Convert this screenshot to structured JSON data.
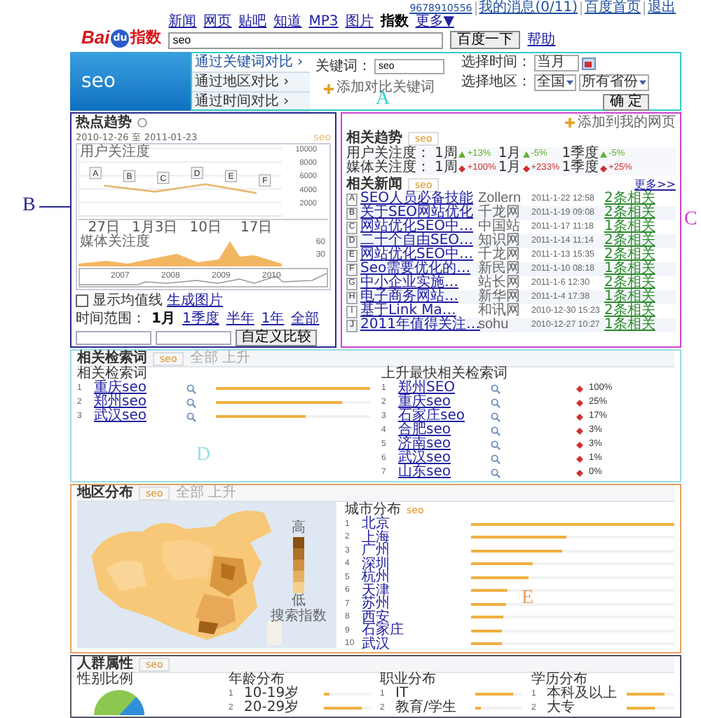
{
  "user_bar": [
    "9678910556",
    "我的消息(0/11)",
    "百度首页",
    "退出"
  ],
  "logo": {
    "left": "Bai",
    "mark": "du",
    "right": "指数"
  },
  "nav": [
    {
      "label": "新闻",
      "selected": false
    },
    {
      "label": "网页",
      "selected": false
    },
    {
      "label": "贴吧",
      "selected": false
    },
    {
      "label": "知道",
      "selected": false
    },
    {
      "label": "MP3",
      "selected": false
    },
    {
      "label": "图片",
      "selected": false
    },
    {
      "label": "指数",
      "selected": true
    },
    {
      "label": "更多▼",
      "selected": false
    }
  ],
  "search": {
    "value": "seo",
    "button": "百度一下",
    "help": "帮助"
  },
  "query": {
    "banner": "seo",
    "modes": [
      {
        "label": "通过关键词对比 ›",
        "selected": true
      },
      {
        "label": "通过地区对比 ›",
        "selected": false
      },
      {
        "label": "通过时间对比 ›",
        "selected": false
      }
    ],
    "keyword_label": "关键词：",
    "keyword": "seo",
    "add_link": "添加对比关键词",
    "time_label": "选择时间：",
    "time": "当月",
    "region_label": "选择地区：",
    "region": "全国",
    "province": "所有省份",
    "confirm": "确 定"
  },
  "callouts": [
    {
      "label": "A",
      "color": "#33cccc"
    },
    {
      "label": "B",
      "color": "#2a2a90"
    },
    {
      "label": "C",
      "color": "#cc44cc"
    },
    {
      "label": "D",
      "color": "#99dde8"
    },
    {
      "label": "E",
      "color": "#e8a060"
    }
  ],
  "trend": {
    "title": "热点趋势",
    "date_range": "2010-12-26 至 2011-01-23",
    "user_label": "用户关注度",
    "chart_data": {
      "type": "line",
      "categories": [
        "27日",
        "1月3日",
        "10日",
        "17日"
      ],
      "series": [
        {
          "name": "seo",
          "color": "#e8b870",
          "values": [
            4500,
            3600,
            4700,
            3400
          ]
        }
      ],
      "ylim": [
        0,
        10000
      ],
      "yticks": [
        2000,
        4000,
        6000,
        8000,
        10000
      ],
      "grid": true,
      "annotations": [
        "A",
        "B",
        "C",
        "D",
        "E",
        "F"
      ]
    },
    "media_label": "媒体关注度",
    "media_ticks": [
      "60",
      "30"
    ],
    "years": [
      "2007",
      "2008",
      "2009",
      "2010"
    ],
    "show_avg": {
      "label": "显示均值线",
      "checked": false
    },
    "image_link": "生成图片",
    "range_label": "时间范围：",
    "ranges": [
      {
        "label": "1月",
        "selected": true
      },
      {
        "label": "1季度",
        "selected": false
      },
      {
        "label": "半年",
        "selected": false
      },
      {
        "label": "1年",
        "selected": false
      },
      {
        "label": "全部",
        "selected": false
      }
    ],
    "compare_button": "自定义比较"
  },
  "side": {
    "add_link": "添加到我的网页",
    "related_trend": {
      "title": "相关趋势",
      "tab": "seo",
      "rows": [
        {
          "label": "用户关注度：",
          "items": [
            {
              "period": "1周",
              "rising": true,
              "change": "+13%"
            },
            {
              "period": "1月",
              "rising": true,
              "change": "-5%"
            },
            {
              "period": "1季度",
              "rising": true,
              "change": "-5%"
            }
          ]
        },
        {
          "label": "媒体关注度：",
          "items": [
            {
              "period": "1周",
              "rising": false,
              "change": "+100%"
            },
            {
              "period": "1月",
              "rising": false,
              "change": "+233%"
            },
            {
              "period": "1季度",
              "rising": false,
              "change": "+25%"
            }
          ]
        }
      ]
    },
    "news": {
      "title": "相关新闻",
      "tab": "seo",
      "more": "更多>>",
      "items": [
        {
          "marker": "A",
          "title": "SEO人员必备技能",
          "source": "Zollern",
          "date": "2011-1-22 12:58",
          "related": "2条相关"
        },
        {
          "marker": "B",
          "title": "关于SEO网站优化",
          "source": "千龙网",
          "date": "2011-1-19 09:08",
          "related": "2条相关"
        },
        {
          "marker": "C",
          "title": "网站优化SEO中…",
          "source": "中国站",
          "date": "2011-1-17 11:18",
          "related": "1条相关"
        },
        {
          "marker": "D",
          "title": "二十个自由SEO…",
          "source": "知识网",
          "date": "2011-1-14 11:14",
          "related": "2条相关"
        },
        {
          "marker": "E",
          "title": "网站优化SEO中…",
          "source": "千龙网",
          "date": "2011-1-13 15:35",
          "related": "2条相关"
        },
        {
          "marker": "F",
          "title": "Seo需要优化的…",
          "source": "新民网",
          "date": "2011-1-10 08:18",
          "related": "1条相关"
        },
        {
          "marker": "G",
          "title": "中小企业实施…",
          "source": "站长网",
          "date": "2011-1-6 12:30",
          "related": "2条相关"
        },
        {
          "marker": "H",
          "title": "电子商务网站…",
          "source": "新华网",
          "date": "2011-1-4 17:38",
          "related": "1条相关"
        },
        {
          "marker": "I",
          "title": "基于Link Ma…",
          "source": "和讯网",
          "date": "2010-12-30 15:23",
          "related": "2条相关"
        },
        {
          "marker": "J",
          "title": "2011年值得关注…",
          "source": "sohu",
          "date": "2010-12-27 10:27",
          "related": "1条相关"
        }
      ]
    }
  },
  "related": {
    "title": "相关检索词",
    "tab": "seo",
    "options": "全部 上升",
    "left_title": "相关检索词",
    "left": [
      {
        "rank": "1",
        "word": "重庆seo",
        "level": 1.0
      },
      {
        "rank": "2",
        "word": "郑州seo",
        "level": 0.82
      },
      {
        "rank": "3",
        "word": "武汉seo",
        "level": 0.58
      }
    ],
    "right_title": "上升最快相关检索词",
    "right": [
      {
        "rank": "1",
        "word": "郑州SEO",
        "change": "100%"
      },
      {
        "rank": "2",
        "word": "重庆seo",
        "change": "25%"
      },
      {
        "rank": "3",
        "word": "石家庄seo",
        "change": "17%"
      },
      {
        "rank": "4",
        "word": "合肥seo",
        "change": "3%"
      },
      {
        "rank": "5",
        "word": "济南seo",
        "change": "3%"
      },
      {
        "rank": "6",
        "word": "武汉seo",
        "change": "1%"
      },
      {
        "rank": "7",
        "word": "山东seo",
        "change": "0%"
      }
    ]
  },
  "regions": {
    "title": "地区分布",
    "tab": "seo",
    "options": "全部 上升",
    "legend_high": "高",
    "legend_low": "低",
    "legend_caption": "搜索指数",
    "list_title": "城市分布",
    "list_tab": "seo",
    "cities": [
      {
        "rank": "1",
        "name": "北京",
        "level": 1.0
      },
      {
        "rank": "2",
        "name": "上海",
        "level": 0.47
      },
      {
        "rank": "3",
        "name": "广州",
        "level": 0.45
      },
      {
        "rank": "4",
        "name": "深圳",
        "level": 0.3
      },
      {
        "rank": "5",
        "name": "杭州",
        "level": 0.28
      },
      {
        "rank": "6",
        "name": "天津",
        "level": 0.18
      },
      {
        "rank": "7",
        "name": "苏州",
        "level": 0.17
      },
      {
        "rank": "8",
        "name": "西安",
        "level": 0.16
      },
      {
        "rank": "9",
        "name": "石家庄",
        "level": 0.15
      },
      {
        "rank": "10",
        "name": "武汉",
        "level": 0.15
      }
    ]
  },
  "people": {
    "title": "人群属性",
    "tab": "seo",
    "gender_title": "性别比例",
    "groups": [
      {
        "title": "年龄分布",
        "items": [
          {
            "rank": "1",
            "label": "10-19岁",
            "level": 0.12
          },
          {
            "rank": "2",
            "label": "20-29岁",
            "level": 0.8
          }
        ]
      },
      {
        "title": "职业分布",
        "items": [
          {
            "rank": "1",
            "label": "IT",
            "level": 0.8
          },
          {
            "rank": "2",
            "label": "教育/学生",
            "level": 0.12
          }
        ]
      },
      {
        "title": "学历分布",
        "items": [
          {
            "rank": "1",
            "label": "本科及以上",
            "level": 0.8
          },
          {
            "rank": "2",
            "label": "大专",
            "level": 0.6
          }
        ]
      }
    ]
  }
}
